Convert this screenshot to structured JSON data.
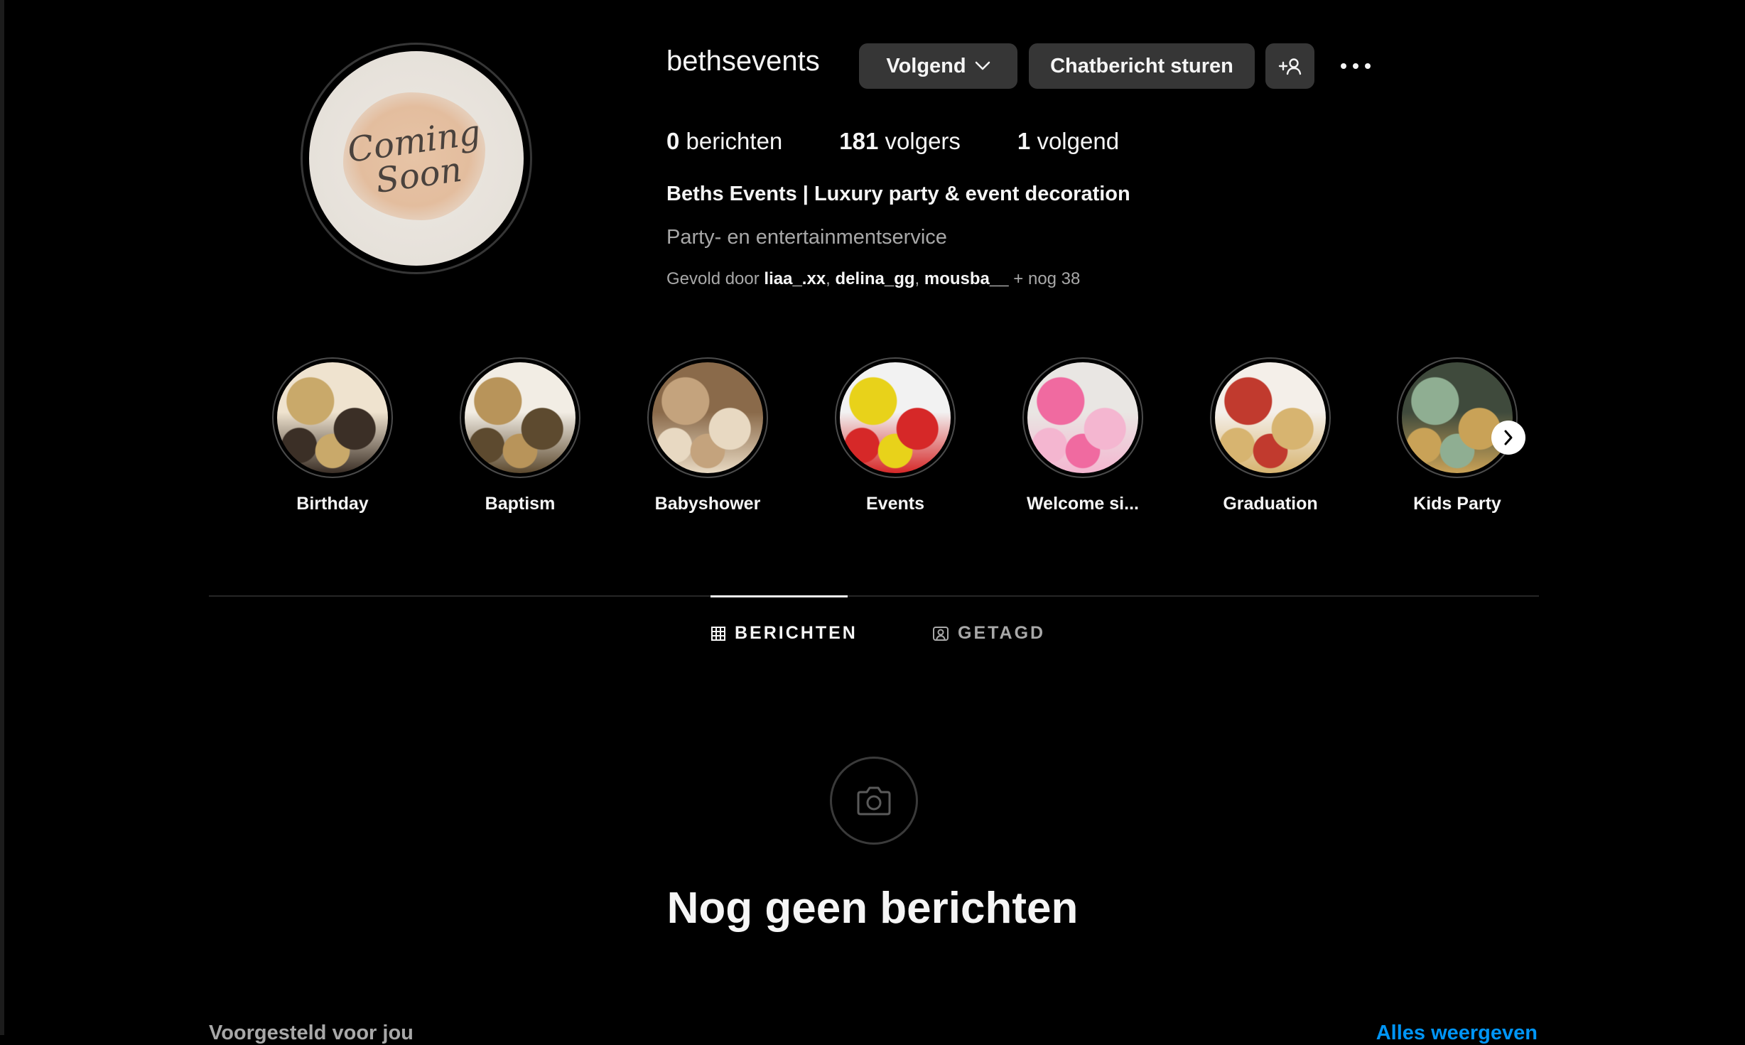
{
  "profile": {
    "username": "bethsevents",
    "avatar_text_line1": "Coming",
    "avatar_text_line2": "Soon",
    "follow_button_label": "Volgend",
    "message_button_label": "Chatbericht sturen",
    "stats": {
      "posts_count": "0",
      "posts_label": "berichten",
      "followers_count": "181",
      "followers_label": "volgers",
      "following_count": "1",
      "following_label": "volgend"
    },
    "full_name": "Beths Events | Luxury party & event decoration",
    "category": "Party- en entertainmentservice",
    "followed_by": {
      "prefix": "Gevold door",
      "users": [
        "liaa_.xx",
        "delina_gg",
        "mousba__"
      ],
      "more": "+ nog 38"
    }
  },
  "highlights": [
    {
      "label": "Birthday",
      "colors": [
        "#c9a96a",
        "#3b2f26",
        "#efe3cf"
      ]
    },
    {
      "label": "Baptism",
      "colors": [
        "#b8945a",
        "#5d4a2f",
        "#f2ede4"
      ]
    },
    {
      "label": "Babyshower",
      "colors": [
        "#c4a37d",
        "#e8d9c2",
        "#8a6a4a"
      ]
    },
    {
      "label": "Events",
      "colors": [
        "#e8d21a",
        "#d62828",
        "#f2f2f2"
      ]
    },
    {
      "label": "Welcome si...",
      "colors": [
        "#f06aa0",
        "#f4b6d0",
        "#e9e6e3"
      ]
    },
    {
      "label": "Graduation",
      "colors": [
        "#c13a2e",
        "#d7b470",
        "#f4efe9"
      ]
    },
    {
      "label": "Kids Party",
      "colors": [
        "#8fae92",
        "#c9a257",
        "#3f4a3c"
      ]
    }
  ],
  "tabs": [
    {
      "label": "BERICHTEN",
      "icon": "grid-icon",
      "active": true
    },
    {
      "label": "GETAGD",
      "icon": "tag-user-icon",
      "active": false
    }
  ],
  "empty_state": {
    "icon": "camera-icon",
    "title": "Nog geen berichten"
  },
  "suggested": {
    "label": "Voorgesteld voor jou",
    "see_all": "Alles weergeven"
  },
  "colors": {
    "background": "#000000",
    "button": "#363636",
    "muted_text": "#a8a8a8",
    "link_blue": "#0095f6"
  }
}
